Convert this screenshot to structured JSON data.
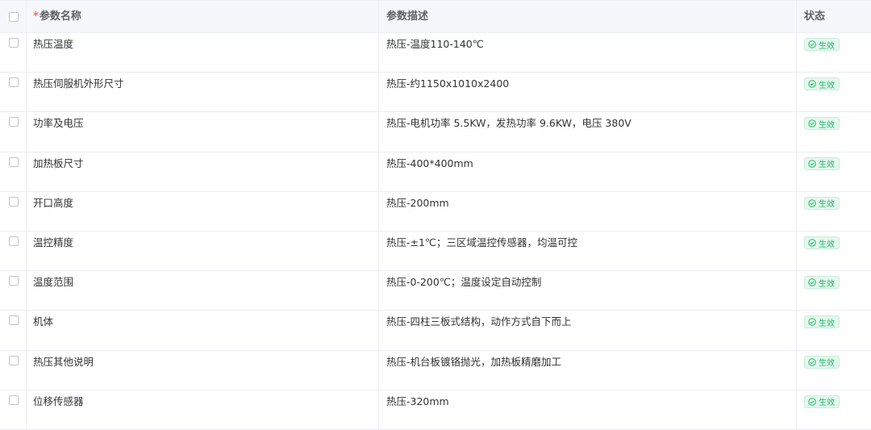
{
  "header": {
    "required_mark": "*",
    "name": "参数名称",
    "desc": "参数描述",
    "status": "状态"
  },
  "colors": {
    "accent_green": "#1fb866",
    "required_red": "#f56c6c"
  },
  "rows": [
    {
      "name": "热压温度",
      "desc": "热压-温度110-140℃",
      "status": "生效"
    },
    {
      "name": "热压伺服机外形尺寸",
      "desc": "热压-约1150x1010x2400",
      "status": "生效"
    },
    {
      "name": "功率及电压",
      "desc": "热压-电机功率 5.5KW，发热功率 9.6KW，电压 380V",
      "status": "生效"
    },
    {
      "name": "加热板尺寸",
      "desc": "热压-400*400mm",
      "status": "生效"
    },
    {
      "name": "开口高度",
      "desc": "热压-200mm",
      "status": "生效"
    },
    {
      "name": "温控精度",
      "desc": "热压-±1℃；三区域温控传感器，均温可控",
      "status": "生效"
    },
    {
      "name": "温度范围",
      "desc": "热压-0-200℃；温度设定自动控制",
      "status": "生效"
    },
    {
      "name": "机体",
      "desc": "热压-四柱三板式结构，动作方式自下而上",
      "status": "生效"
    },
    {
      "name": "热压其他说明",
      "desc": "热压-机台板镀铬抛光，加热板精磨加工",
      "status": "生效"
    },
    {
      "name": "位移传感器",
      "desc": "热压-320mm",
      "status": "生效"
    }
  ]
}
